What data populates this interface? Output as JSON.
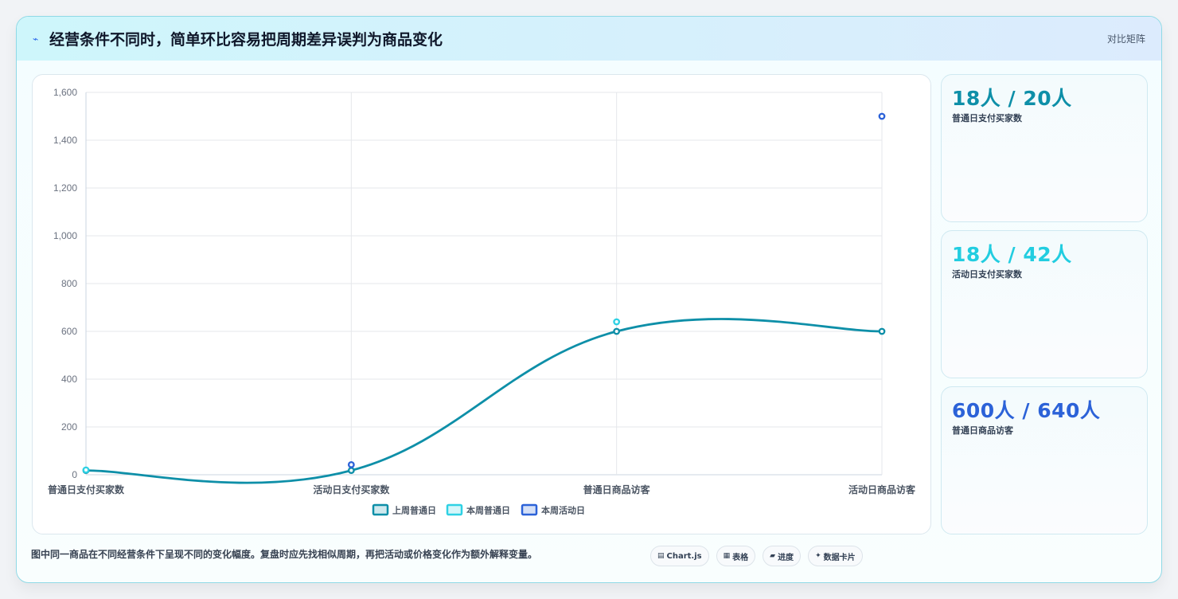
{
  "header": {
    "title": "经营条件不同时，简单环比容易把周期差异误判为商品变化",
    "tag": "对比矩阵",
    "icon": "trend-line-icon"
  },
  "chart_data": {
    "type": "line",
    "categories": [
      "普通日支付买家数",
      "活动日支付买家数",
      "普通日商品访客",
      "活动日商品访客"
    ],
    "ylim": [
      0,
      1600
    ],
    "yticks": [
      0,
      200,
      400,
      600,
      800,
      1000,
      1200,
      1400,
      1600
    ],
    "y_tick_labels": [
      "0",
      "200",
      "400",
      "600",
      "800",
      "1,000",
      "1,200",
      "1,400",
      "1,600"
    ],
    "grid": true,
    "legend_position": "bottom",
    "series": [
      {
        "name": "上周普通日",
        "values": [
          18,
          18,
          600,
          600
        ],
        "color": "#0e8fa8",
        "style": "line"
      },
      {
        "name": "本周普通日",
        "values": [
          20,
          null,
          640,
          null
        ],
        "color": "#2fd1e4",
        "style": "points"
      },
      {
        "name": "本周活动日",
        "values": [
          null,
          42,
          null,
          1500
        ],
        "color": "#2c62d8",
        "style": "points"
      }
    ]
  },
  "kpis": [
    {
      "value": "18人 / 20人",
      "label": "普通日支付买家数",
      "color": "#0e8fa8"
    },
    {
      "value": "18人 / 42人",
      "label": "活动日支付买家数",
      "color": "#22cde0"
    },
    {
      "value": "600人 / 640人",
      "label": "普通日商品访客",
      "color": "#2c62d8"
    }
  ],
  "footer": {
    "note": "图中同一商品在不同经营条件下呈现不同的变化幅度。复盘时应先找相似周期，再把活动或价格变化作为额外解释变量。",
    "pills": [
      {
        "icon": "chart-icon",
        "glyph": "▤",
        "label": "Chart.js"
      },
      {
        "icon": "table-icon",
        "glyph": "▦",
        "label": "表格"
      },
      {
        "icon": "progress-icon",
        "glyph": "▰",
        "label": "进度"
      },
      {
        "icon": "data-card-icon",
        "glyph": "✦",
        "label": "数据卡片"
      }
    ]
  }
}
